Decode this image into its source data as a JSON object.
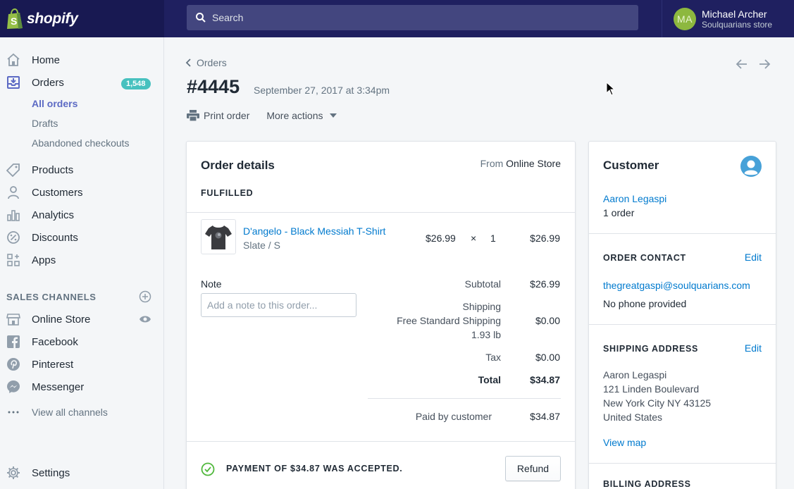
{
  "brand": {
    "name": "shopify"
  },
  "search": {
    "placeholder": "Search"
  },
  "user": {
    "initials": "MA",
    "name": "Michael Archer",
    "store": "Soulquarians store"
  },
  "sidebar": {
    "home": "Home",
    "orders": "Orders",
    "orders_badge": "1,548",
    "orders_sub": [
      "All orders",
      "Drafts",
      "Abandoned checkouts"
    ],
    "products": "Products",
    "customers": "Customers",
    "analytics": "Analytics",
    "discounts": "Discounts",
    "apps": "Apps",
    "sales_channels_title": "SALES CHANNELS",
    "channels": [
      "Online Store",
      "Facebook",
      "Pinterest",
      "Messenger"
    ],
    "view_all": "View all channels",
    "settings": "Settings"
  },
  "breadcrumb": "Orders",
  "order": {
    "number": "#4445",
    "date": "September 27, 2017 at 3:34pm",
    "print": "Print order",
    "more_actions": "More actions"
  },
  "details": {
    "title": "Order details",
    "from_label": "From",
    "from_value": "Online Store",
    "status": "FULFILLED",
    "item": {
      "name": "D'angelo - Black Messiah T-Shirt",
      "variant": "Slate / S",
      "price": "$26.99",
      "times": "×",
      "qty": "1",
      "total": "$26.99"
    },
    "note_label": "Note",
    "note_placeholder": "Add a note to this order...",
    "subtotal_label": "Subtotal",
    "subtotal": "$26.99",
    "shipping_label": "Shipping",
    "shipping_method": "Free Standard Shipping",
    "shipping_weight": "1.93 lb",
    "shipping": "$0.00",
    "tax_label": "Tax",
    "tax": "$0.00",
    "total_label": "Total",
    "total": "$34.87",
    "paid_label": "Paid by customer",
    "paid": "$34.87",
    "payment_msg": "PAYMENT OF $34.87 WAS ACCEPTED.",
    "refund": "Refund"
  },
  "customer": {
    "title": "Customer",
    "name": "Aaron Legaspi",
    "orders": "1 order",
    "contact_title": "ORDER CONTACT",
    "edit": "Edit",
    "email": "thegreatgaspi@soulquarians.com",
    "phone": "No phone provided",
    "shipping_title": "SHIPPING ADDRESS",
    "address": [
      "Aaron Legaspi",
      "121 Linden Boulevard",
      "New York City NY 43125",
      "United States"
    ],
    "view_map": "View map",
    "billing_title": "BILLING ADDRESS"
  },
  "colors": {
    "topbar": "#1f2060",
    "accent": "#5c6ac4",
    "link": "#007ace",
    "badge": "#47c1bf",
    "success": "#50b83c"
  }
}
